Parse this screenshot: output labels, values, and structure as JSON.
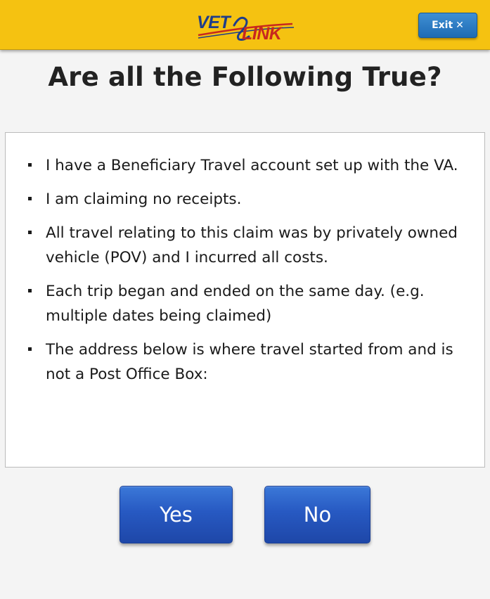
{
  "header": {
    "logo": {
      "word1": "VET",
      "word2": "LINK"
    },
    "exit_label": "Exit",
    "exit_icon": "close-icon"
  },
  "title": "Are all the Following True?",
  "statements": [
    "I have a Beneficiary Travel account set up with the VA.",
    "I am claiming no receipts.",
    "All travel relating to this claim was by privately owned vehicle (POV) and I incurred all costs.",
    "Each trip began and ended on the same day. (e.g. multiple dates being claimed)",
    "The address below is where travel started from and is not a Post Office Box:"
  ],
  "buttons": {
    "yes_label": "Yes",
    "no_label": "No"
  },
  "colors": {
    "header_bg": "#f5c211",
    "button_blue": "#2759c2",
    "logo_blue": "#1f3d8a",
    "logo_red": "#c8281e"
  }
}
